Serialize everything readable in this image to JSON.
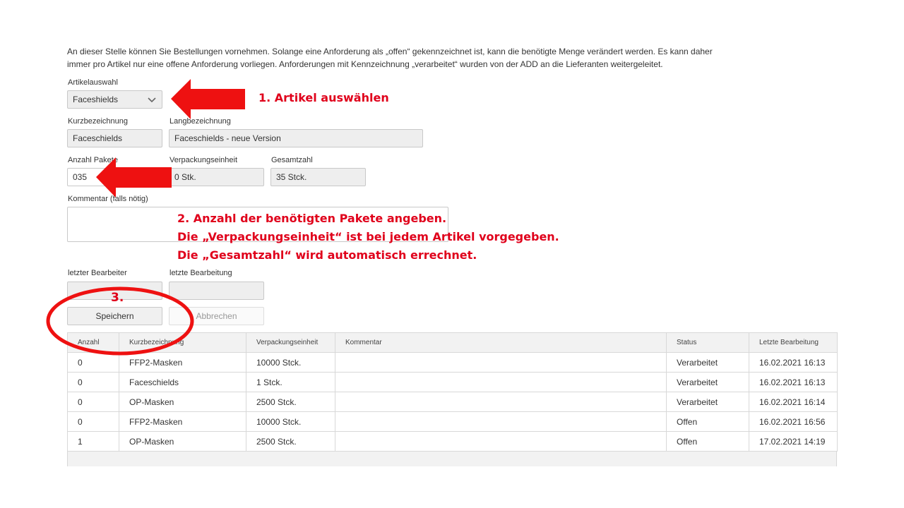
{
  "intro": {
    "line1": "An dieser Stelle können Sie Bestellungen vornehmen. Solange eine Anforderung als „offen“ gekennzeichnet ist, kann die benötigte Menge verändert werden. Es kann daher",
    "line2": "immer pro Artikel nur eine offene Anforderung vorliegen. Anforderungen mit Kennzeichnung „verarbeitet“ wurden von der ADD an die Lieferanten weitergeleitet."
  },
  "form": {
    "artikelauswahl_label": "Artikelauswahl",
    "artikelauswahl_value": "Faceshields",
    "kurz_label": "Kurzbezeichnung",
    "kurz_value": "Faceschields",
    "lang_label": "Langbezeichnung",
    "lang_value": "Faceschields - neue Version",
    "anzahl_label": "Anzahl Pakete",
    "anzahl_value": "035",
    "ve_label": "Verpackungseinheit",
    "ve_value": "0 Stk.",
    "gesamt_label": "Gesamtzahl",
    "gesamt_value": "35 Stck.",
    "kommentar_label": "Kommentar (falls nötig)",
    "bearbeiter_label": "letzter Bearbeiter",
    "bearbeitung_label": "letzte Bearbeitung",
    "save_label": "Speichern",
    "cancel_label": "Abbrechen"
  },
  "table": {
    "headers": [
      "Anzahl",
      "Kurzbezeichnung",
      "Verpackungseinheit",
      "Kommentar",
      "Status",
      "Letzte Bearbeitung"
    ],
    "rows": [
      [
        "0",
        "FFP2-Masken",
        "10000 Stck.",
        "",
        "Verarbeitet",
        "16.02.2021 16:13"
      ],
      [
        "0",
        "Faceschields",
        "1 Stck.",
        "",
        "Verarbeitet",
        "16.02.2021 16:13"
      ],
      [
        "0",
        "OP-Masken",
        "2500 Stck.",
        "",
        "Verarbeitet",
        "16.02.2021 16:14"
      ],
      [
        "0",
        "FFP2-Masken",
        "10000 Stck.",
        "",
        "Offen",
        "16.02.2021 16:56"
      ],
      [
        "1",
        "OP-Masken",
        "2500 Stck.",
        "",
        "Offen",
        "17.02.2021 14:19"
      ]
    ]
  },
  "annotations": {
    "step1": "1. Artikel auswählen",
    "step2_line1": "2. Anzahl der benötigten Pakete angeben.",
    "step2_line2": "Die „Verpackungseinheit“ ist bei jedem Artikel vorgegeben.",
    "step2_line3": "Die „Gesamtzahl“ wird automatisch errechnet.",
    "step3": "3."
  },
  "colors": {
    "annotation_red": "#e0001b"
  }
}
